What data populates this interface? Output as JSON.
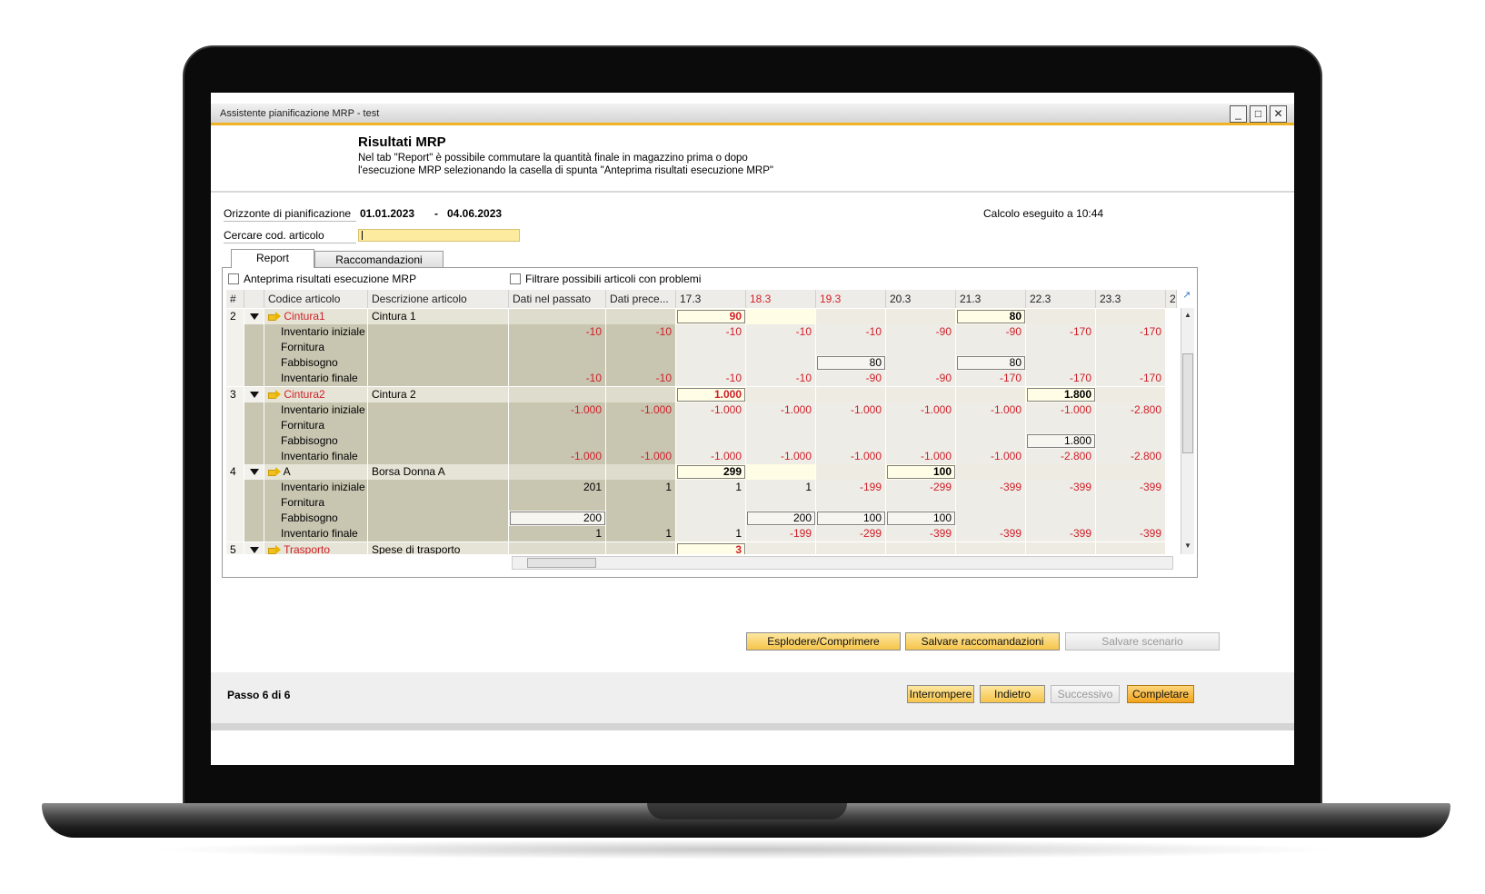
{
  "window": {
    "title": "Assistente pianificazione MRP - test",
    "minimize_glyph": "_",
    "maximize_glyph": "□",
    "close_glyph": "✕"
  },
  "header": {
    "title": "Risultati MRP",
    "desc_line1": "Nel tab \"Report\" è possibile commutare la quantità finale in magazzino prima o dopo",
    "desc_line2": "l'esecuzione MRP selezionando la casella di spunta \"Anteprima risultati esecuzione MRP\""
  },
  "form": {
    "horizon_label": "Orizzonte di pianificazione",
    "date_from": "01.01.2023",
    "date_sep": "-",
    "date_to": "04.06.2023",
    "calc_label": "Calcolo eseguito a 10:44",
    "search_label": "Cercare cod. articolo"
  },
  "tabs": {
    "report": "Report",
    "recommendations": "Raccomandazioni"
  },
  "checks": {
    "preview": "Anteprima risultati esecuzione MRP",
    "filter": "Filtrare possibili articoli con problemi"
  },
  "grid": {
    "headers": [
      "#",
      "",
      "Codice articolo",
      "Descrizione articolo",
      "Dati nel passato",
      "Dati prece...",
      "17.3",
      "18.3",
      "19.3",
      "20.3",
      "21.3",
      "22.3",
      "23.3",
      "2"
    ],
    "rows": [
      {
        "kind": "item",
        "num": "2",
        "code": "Cintura1",
        "code_red": true,
        "desc": "Cintura 1",
        "vals": [
          "",
          "",
          "90",
          "",
          "",
          "",
          "80",
          "",
          ""
        ],
        "big": [
          2,
          6
        ]
      },
      {
        "kind": "sub",
        "label": "Inventario iniziale",
        "vals": [
          "-10",
          "-10",
          "-10",
          "-10",
          "-10",
          "-90",
          "-90",
          "-170",
          "-170"
        ]
      },
      {
        "kind": "sub",
        "label": "Fornitura",
        "vals": [
          "",
          "",
          "",
          "",
          "",
          "",
          "",
          "",
          ""
        ]
      },
      {
        "kind": "sub",
        "label": "Fabbisogno",
        "vals": [
          "",
          "",
          "",
          "",
          "80",
          "",
          "80",
          "",
          ""
        ],
        "boxed": [
          4,
          6
        ]
      },
      {
        "kind": "sub",
        "label": "Inventario finale",
        "vals": [
          "-10",
          "-10",
          "-10",
          "-10",
          "-90",
          "-90",
          "-170",
          "-170",
          "-170"
        ]
      },
      {
        "kind": "item",
        "num": "3",
        "code": "Cintura2",
        "code_red": true,
        "desc": "Cintura 2",
        "vals": [
          "",
          "",
          "1.000",
          "",
          "",
          "",
          "",
          "1.800",
          ""
        ],
        "big": [
          2,
          7
        ]
      },
      {
        "kind": "sub",
        "label": "Inventario iniziale",
        "vals": [
          "-1.000",
          "-1.000",
          "-1.000",
          "-1.000",
          "-1.000",
          "-1.000",
          "-1.000",
          "-1.000",
          "-2.800"
        ]
      },
      {
        "kind": "sub",
        "label": "Fornitura",
        "vals": [
          "",
          "",
          "",
          "",
          "",
          "",
          "",
          "",
          ""
        ]
      },
      {
        "kind": "sub",
        "label": "Fabbisogno",
        "vals": [
          "",
          "",
          "",
          "",
          "",
          "",
          "",
          "1.800",
          ""
        ],
        "boxed": [
          7
        ]
      },
      {
        "kind": "sub",
        "label": "Inventario finale",
        "vals": [
          "-1.000",
          "-1.000",
          "-1.000",
          "-1.000",
          "-1.000",
          "-1.000",
          "-1.000",
          "-2.800",
          "-2.800"
        ]
      },
      {
        "kind": "item",
        "num": "4",
        "code": "A",
        "code_red": false,
        "desc": "Borsa Donna A",
        "vals": [
          "",
          "",
          "299",
          "",
          "",
          "100",
          "",
          "",
          ""
        ],
        "big": [
          2,
          5
        ]
      },
      {
        "kind": "sub",
        "label": "Inventario iniziale",
        "vals": [
          "201",
          "1",
          "1",
          "1",
          "-199",
          "-299",
          "-399",
          "-399",
          "-399"
        ]
      },
      {
        "kind": "sub",
        "label": "Fornitura",
        "vals": [
          "",
          "",
          "",
          "",
          "",
          "",
          "",
          "",
          ""
        ]
      },
      {
        "kind": "sub",
        "label": "Fabbisogno",
        "vals": [
          "200",
          "",
          "",
          "200",
          "100",
          "100",
          "",
          "",
          ""
        ],
        "boxed": [
          0,
          3,
          4,
          5
        ]
      },
      {
        "kind": "sub",
        "label": "Inventario finale",
        "vals": [
          "1",
          "1",
          "1",
          "-199",
          "-299",
          "-399",
          "-399",
          "-399",
          "-399"
        ]
      },
      {
        "kind": "item",
        "num": "5",
        "code": "Trasporto",
        "code_red": true,
        "desc": "Spese di trasporto",
        "vals": [
          "",
          "",
          "3",
          "",
          "",
          "",
          "",
          "",
          ""
        ],
        "big": [
          2
        ],
        "red_big": true
      }
    ]
  },
  "buttons": {
    "explode": "Esplodere/Comprimere",
    "save_rec": "Salvare raccomandazioni",
    "save_scen": "Salvare scenario",
    "abort": "Interrompere",
    "back": "Indietro",
    "next": "Successivo",
    "finish": "Completare"
  },
  "footer": {
    "step": "Passo 6 di 6"
  },
  "colors": {
    "accent": "#f0b323",
    "negative": "#d0202a",
    "sidebar": "#c8c5b0",
    "highlight": "#fffde6"
  }
}
